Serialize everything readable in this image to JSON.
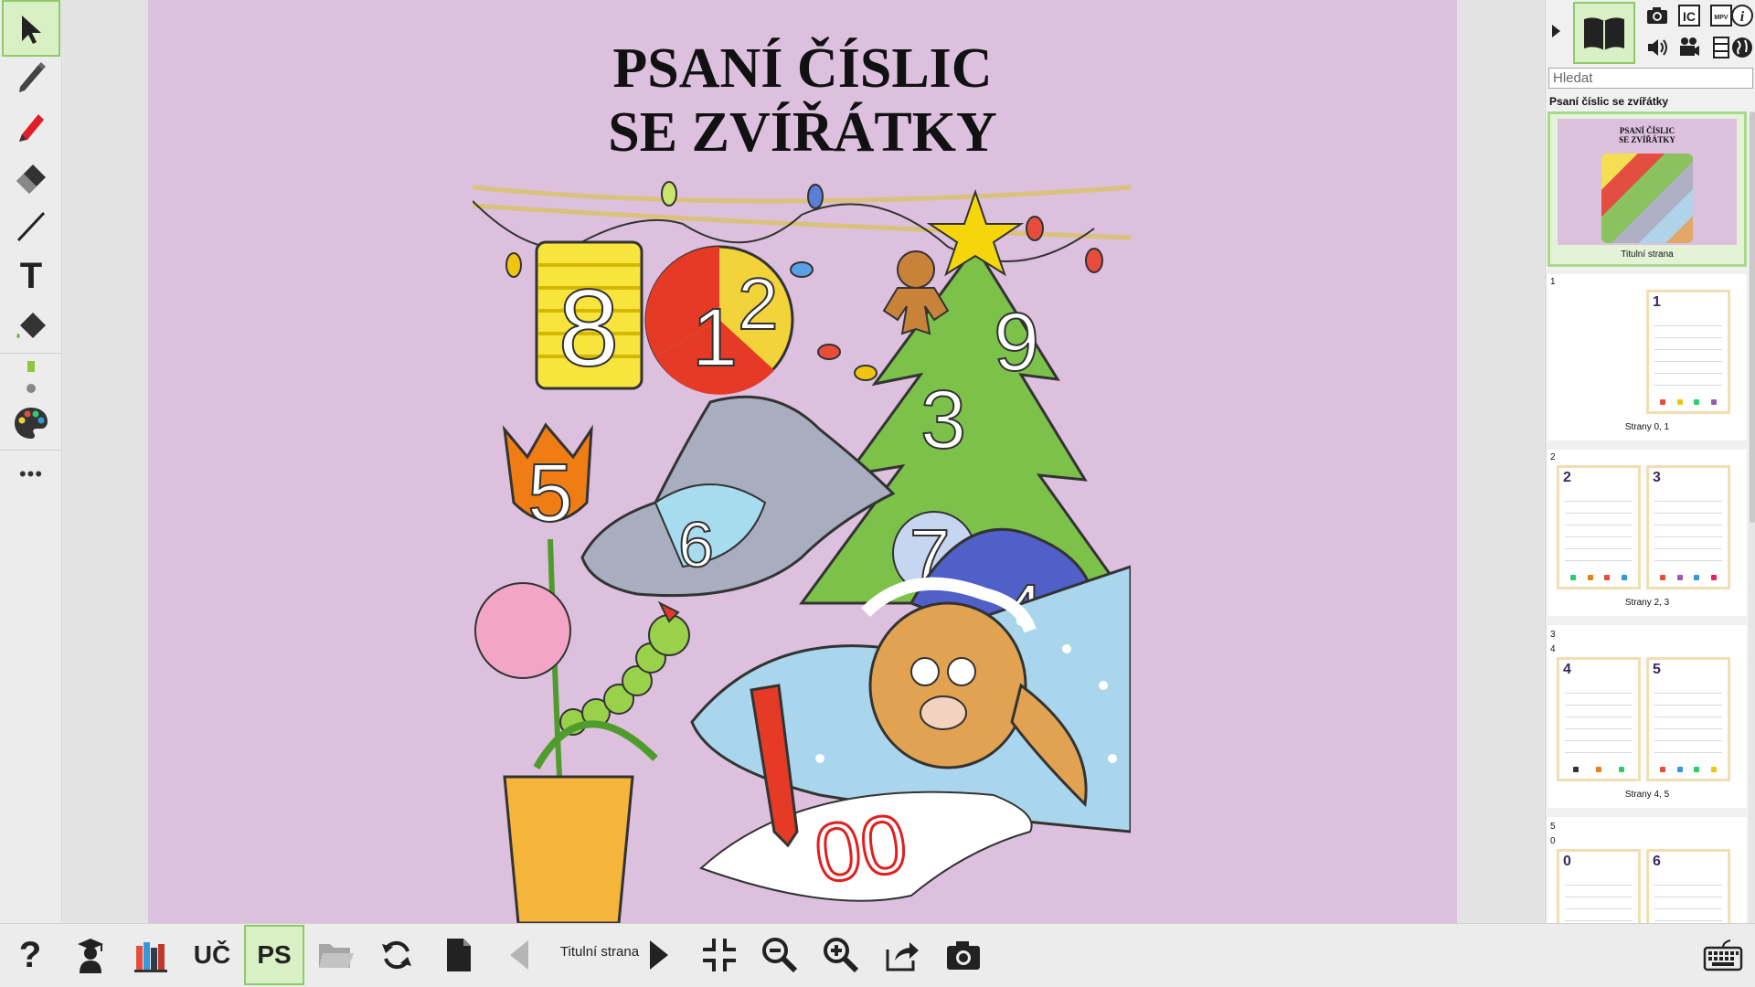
{
  "left_toolbar": {
    "tools": [
      {
        "name": "select-arrow-icon",
        "active": true
      },
      {
        "name": "pencil-icon",
        "active": false
      },
      {
        "name": "marker-icon",
        "active": false
      },
      {
        "name": "eraser-icon",
        "active": false
      },
      {
        "name": "line-icon",
        "active": false
      },
      {
        "name": "text-tool-icon",
        "active": false
      },
      {
        "name": "fill-bucket-icon",
        "active": false
      },
      {
        "name": "line-width-icon",
        "active": false
      },
      {
        "name": "color-palette-icon",
        "active": false
      },
      {
        "name": "more-icon",
        "active": false
      }
    ],
    "text_tool_glyph": "T",
    "more_glyph": "•••",
    "colors": {
      "marker": "#e11d2a",
      "active_bg": "#d8f0c4",
      "accent_green": "#8fc96a"
    }
  },
  "page": {
    "title_line1": "PSANÍ ČÍSLIC",
    "title_line2": "SE ZVÍŘÁTKY",
    "background": "#dcc0de",
    "illustration": {
      "lantern_number": "8",
      "ball_numbers": [
        "1",
        "2"
      ],
      "tree_numbers": [
        "9",
        "3"
      ],
      "tulip_number": "5",
      "seal_number": "6",
      "pompom_number": "7",
      "hat_number": "4",
      "drawn_digits": "00"
    }
  },
  "right_panel": {
    "search_placeholder": "Hledat",
    "book_name": "Psaní číslic se zvířátky",
    "icons": [
      "book-icon",
      "camera-icon",
      "ic-icon",
      "mpv-icon",
      "info-icon",
      "speaker-icon",
      "video-camera-icon",
      "film-icon",
      "globe-icon"
    ],
    "icon_labels": {
      "ic": "IC",
      "mpv": "MPV",
      "info": "i"
    },
    "thumbnails": [
      {
        "num": "",
        "caption": "Titulní strana",
        "selected": true
      },
      {
        "num": "1",
        "caption": "Strany 0, 1",
        "pages": [
          "",
          "1"
        ]
      },
      {
        "num": "2",
        "caption": "Strany 2, 3",
        "pages": [
          "2",
          "3"
        ]
      },
      {
        "num": "3\n4",
        "caption": "Strany 4, 5",
        "pages": [
          "4",
          "5"
        ]
      },
      {
        "num": "5\n0",
        "caption": "",
        "pages": [
          "0",
          "6"
        ]
      }
    ]
  },
  "bottom_toolbar": {
    "uc_label": "UČ",
    "ps_label": "PS",
    "page_label": "Titulní strana",
    "help_glyph": "?"
  }
}
